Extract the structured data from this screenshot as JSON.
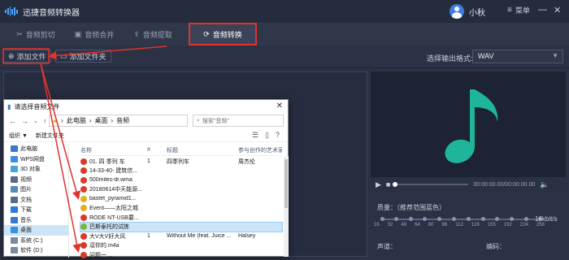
{
  "app": {
    "title": "迅捷音频转换器",
    "user_name": "小秋",
    "menu_label": "菜单"
  },
  "window_controls": {
    "minimize": "—",
    "close": "✕"
  },
  "tabs": [
    {
      "label": "音频剪切",
      "icon": "scissors-icon"
    },
    {
      "label": "音频合并",
      "icon": "merge-icon"
    },
    {
      "label": "音频提取",
      "icon": "extract-icon"
    },
    {
      "label": "音频转换",
      "icon": "refresh-icon",
      "active": true
    }
  ],
  "toolbar": {
    "add_file": "添加文件",
    "add_folder": "添加文件夹",
    "format_label": "选择输出格式:",
    "format_value": "WAV"
  },
  "player": {
    "time": "00:00:00.00/00:00:00.00"
  },
  "settings": {
    "quality_label": "质量：（推荐范围蓝色）",
    "bitrate_unit": "16kbit/s",
    "bitrate_ticks": [
      "16",
      "32",
      "48",
      "64",
      "80",
      "96",
      "112",
      "128",
      "155",
      "192",
      "224",
      "256"
    ],
    "channel_label": "声道：",
    "encoding_label": "编码："
  },
  "dialog": {
    "title": "请选择音频文件",
    "breadcrumb": [
      "此电脑",
      "桌面",
      "音频"
    ],
    "search_placeholder": "搜索\"音频\"",
    "organize": "组织 ▼",
    "new_folder": "新建文件夹",
    "columns": {
      "name": "名称",
      "number": "#",
      "title": "标题",
      "artist": "参与创作的艺术家"
    },
    "tree": [
      {
        "label": "此电脑",
        "color": "#3a78c8"
      },
      {
        "label": "WPS网盘",
        "color": "#3a8ee0"
      },
      {
        "label": "3D 对象",
        "color": "#4aa3d8"
      },
      {
        "label": "视频",
        "color": "#5a6b8a"
      },
      {
        "label": "图片",
        "color": "#5a8ab8"
      },
      {
        "label": "文档",
        "color": "#5a6b8a"
      },
      {
        "label": "下载",
        "color": "#2a7ad8"
      },
      {
        "label": "音乐",
        "color": "#3a78c8"
      },
      {
        "label": "桌面",
        "color": "#3a8ee0",
        "selected": true
      },
      {
        "label": "系统 (C:)",
        "color": "#7a8aa0"
      },
      {
        "label": "软件 (D:)",
        "color": "#7a8aa0"
      }
    ],
    "files": [
      {
        "name": "01. 四 季列 车",
        "number": "1",
        "title": "四季列车",
        "artist": "周杰伦",
        "icon_color": "#d93a2a"
      },
      {
        "name": "14-33-40- 建筑信...",
        "number": "",
        "title": "",
        "artist": "",
        "icon_color": "#d93a2a"
      },
      {
        "name": "500miles-dr.wma",
        "number": "",
        "title": "",
        "artist": "",
        "icon_color": "#d93a2a"
      },
      {
        "name": "20180614中天能源...",
        "number": "",
        "title": "",
        "artist": "",
        "icon_color": "#d93a2a"
      },
      {
        "name": "bastet_pyramid1...",
        "number": "",
        "title": "",
        "artist": "",
        "icon_color": "#e0b020"
      },
      {
        "name": "Event——太阳之城",
        "number": "",
        "title": "",
        "artist": "",
        "icon_color": "#e0b020"
      },
      {
        "name": "RODE NT-USB要...",
        "number": "",
        "title": "",
        "artist": "",
        "icon_color": "#d93a2a"
      },
      {
        "name": "巴斯泰托的试炼",
        "number": "",
        "title": "",
        "artist": "",
        "icon_color": "#7ab83a",
        "selected": true
      },
      {
        "name": "大V大V好大风",
        "number": "1",
        "title": "Without Me (feat. Juice ...",
        "artist": "Halsey",
        "icon_color": "#d93a2a"
      },
      {
        "name": "逗你的.m4a",
        "number": "",
        "title": "",
        "artist": "",
        "icon_color": "#d93a2a"
      },
      {
        "name": "问题一 ...",
        "number": "",
        "title": "",
        "artist": "",
        "icon_color": "#d93a2a"
      }
    ]
  },
  "colors": {
    "accent": "#4aa3ff",
    "annotation": "#e0322e",
    "music_note": "#1fb59a"
  }
}
